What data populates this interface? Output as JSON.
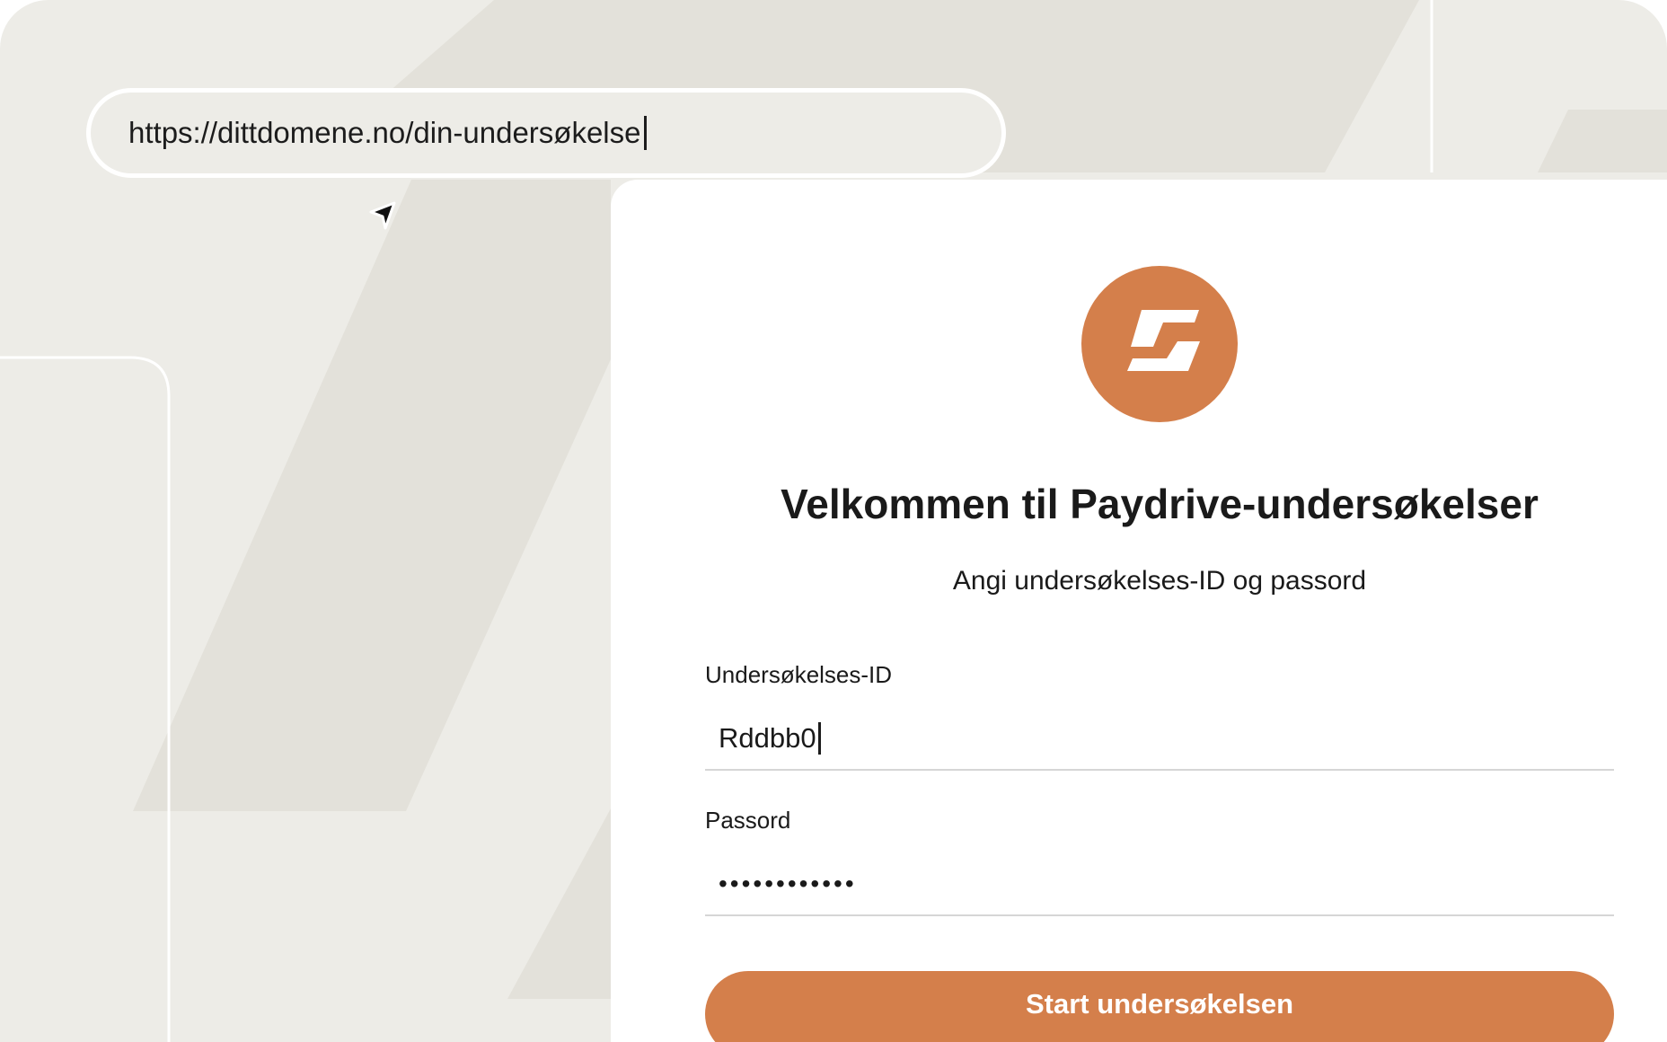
{
  "browser": {
    "url": "https://dittdomene.no/din-undersøkelse"
  },
  "login_card": {
    "title": "Velkommen til Paydrive-undersøkelser",
    "subtitle": "Angi undersøkelses-ID og passord",
    "survey_id": {
      "label": "Undersøkelses-ID",
      "value": "Rddbb0"
    },
    "password": {
      "label": "Passord",
      "masked_value": "••••••••••••"
    },
    "start_button_label": "Start undersøkelsen"
  },
  "colors": {
    "accent": "#d47f4b",
    "background": "#edece7",
    "stripe": "#e3e1da",
    "card": "#ffffff",
    "text": "#1a1a1a"
  },
  "icons": {
    "logo": "paydrive-logo-icon",
    "pointer": "mouse-pointer-icon"
  }
}
